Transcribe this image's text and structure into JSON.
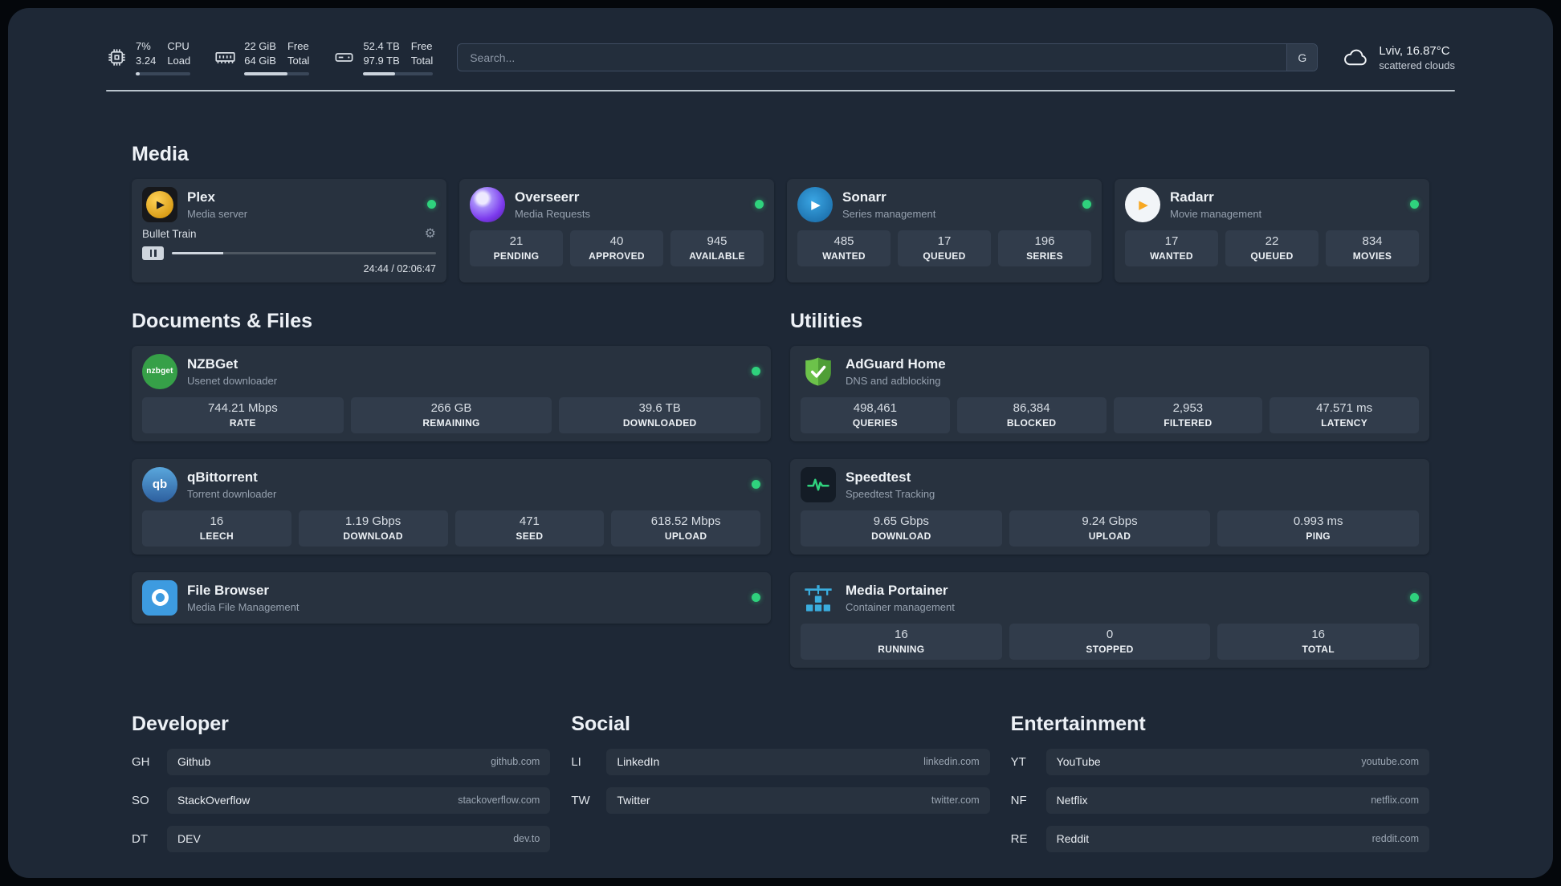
{
  "colors": {
    "page_bg": "#1e2836",
    "card_bg": "#28323f",
    "stat_bg": "#313c4b",
    "status_online": "#2fd27d",
    "plex_amber": "#e5a00d",
    "overseerr_purple": "#7c3aed",
    "sonarr_blue": "#2d9de0",
    "radarr_amber": "#f7a823",
    "nzbget_green": "#36a048",
    "qbittorrent_blue": "#2d5f9e",
    "filebrowser_blue": "#3d9be0",
    "adguard_green": "#67c23a",
    "speedtest_green": "#2fd27d",
    "portainer_blue": "#3aadde"
  },
  "icons": {
    "gear": "⚙",
    "play": "▶",
    "nzbget_text": "nzbget",
    "qb_text": "qb"
  },
  "topbar": {
    "resources": [
      {
        "name": "cpu",
        "v1": "7%",
        "v2": "3.24",
        "l1": "CPU",
        "l2": "Load",
        "bar_percent": 7
      },
      {
        "name": "memory",
        "v1": "22 GiB",
        "v2": "64 GiB",
        "l1": "Free",
        "l2": "Total",
        "bar_percent": 66
      },
      {
        "name": "disk",
        "v1": "52.4 TB",
        "v2": "97.9 TB",
        "l1": "Free",
        "l2": "Total",
        "bar_percent": 46
      }
    ],
    "search": {
      "placeholder": "Search...",
      "provider_label": "G"
    },
    "weather": {
      "location": "Lviv, 16.87°C",
      "condition": "scattered clouds"
    }
  },
  "sections": {
    "media": {
      "title": "Media"
    },
    "documents": {
      "title": "Documents & Files"
    },
    "utilities": {
      "title": "Utilities"
    }
  },
  "services": {
    "plex": {
      "name": "Plex",
      "desc": "Media server",
      "status": "online",
      "player": {
        "title": "Bullet Train",
        "time": "24:44 / 02:06:47",
        "progress_percent": 19.5
      }
    },
    "overseerr": {
      "name": "Overseerr",
      "desc": "Media Requests",
      "status": "online",
      "stats": [
        {
          "value": "21",
          "label": "PENDING"
        },
        {
          "value": "40",
          "label": "APPROVED"
        },
        {
          "value": "945",
          "label": "AVAILABLE"
        }
      ]
    },
    "sonarr": {
      "name": "Sonarr",
      "desc": "Series management",
      "status": "online",
      "stats": [
        {
          "value": "485",
          "label": "WANTED"
        },
        {
          "value": "17",
          "label": "QUEUED"
        },
        {
          "value": "196",
          "label": "SERIES"
        }
      ]
    },
    "radarr": {
      "name": "Radarr",
      "desc": "Movie management",
      "status": "online",
      "stats": [
        {
          "value": "17",
          "label": "WANTED"
        },
        {
          "value": "22",
          "label": "QUEUED"
        },
        {
          "value": "834",
          "label": "MOVIES"
        }
      ]
    },
    "nzbget": {
      "name": "NZBGet",
      "desc": "Usenet downloader",
      "status": "online",
      "stats": [
        {
          "value": "744.21 Mbps",
          "label": "RATE"
        },
        {
          "value": "266 GB",
          "label": "REMAINING"
        },
        {
          "value": "39.6 TB",
          "label": "DOWNLOADED"
        }
      ]
    },
    "qbittorrent": {
      "name": "qBittorrent",
      "desc": "Torrent downloader",
      "status": "online",
      "stats": [
        {
          "value": "16",
          "label": "LEECH"
        },
        {
          "value": "1.19 Gbps",
          "label": "DOWNLOAD"
        },
        {
          "value": "471",
          "label": "SEED"
        },
        {
          "value": "618.52 Mbps",
          "label": "UPLOAD"
        }
      ]
    },
    "filebrowser": {
      "name": "File Browser",
      "desc": "Media File Management",
      "status": "online"
    },
    "adguard": {
      "name": "AdGuard Home",
      "desc": "DNS and adblocking",
      "stats": [
        {
          "value": "498,461",
          "label": "QUERIES"
        },
        {
          "value": "86,384",
          "label": "BLOCKED"
        },
        {
          "value": "2,953",
          "label": "FILTERED"
        },
        {
          "value": "47.571 ms",
          "label": "LATENCY"
        }
      ]
    },
    "speedtest": {
      "name": "Speedtest",
      "desc": "Speedtest Tracking",
      "stats": [
        {
          "value": "9.65 Gbps",
          "label": "DOWNLOAD"
        },
        {
          "value": "9.24 Gbps",
          "label": "UPLOAD"
        },
        {
          "value": "0.993 ms",
          "label": "PING"
        }
      ]
    },
    "portainer": {
      "name": "Media Portainer",
      "desc": "Container management",
      "status": "online",
      "stats": [
        {
          "value": "16",
          "label": "RUNNING"
        },
        {
          "value": "0",
          "label": "STOPPED"
        },
        {
          "value": "16",
          "label": "TOTAL"
        }
      ]
    }
  },
  "bookmarks": {
    "developer": {
      "title": "Developer",
      "items": [
        {
          "abbr": "GH",
          "name": "Github",
          "domain": "github.com"
        },
        {
          "abbr": "SO",
          "name": "StackOverflow",
          "domain": "stackoverflow.com"
        },
        {
          "abbr": "DT",
          "name": "DEV",
          "domain": "dev.to"
        }
      ]
    },
    "social": {
      "title": "Social",
      "items": [
        {
          "abbr": "LI",
          "name": "LinkedIn",
          "domain": "linkedin.com"
        },
        {
          "abbr": "TW",
          "name": "Twitter",
          "domain": "twitter.com"
        }
      ]
    },
    "entertainment": {
      "title": "Entertainment",
      "items": [
        {
          "abbr": "YT",
          "name": "YouTube",
          "domain": "youtube.com"
        },
        {
          "abbr": "NF",
          "name": "Netflix",
          "domain": "netflix.com"
        },
        {
          "abbr": "RE",
          "name": "Reddit",
          "domain": "reddit.com"
        }
      ]
    }
  }
}
